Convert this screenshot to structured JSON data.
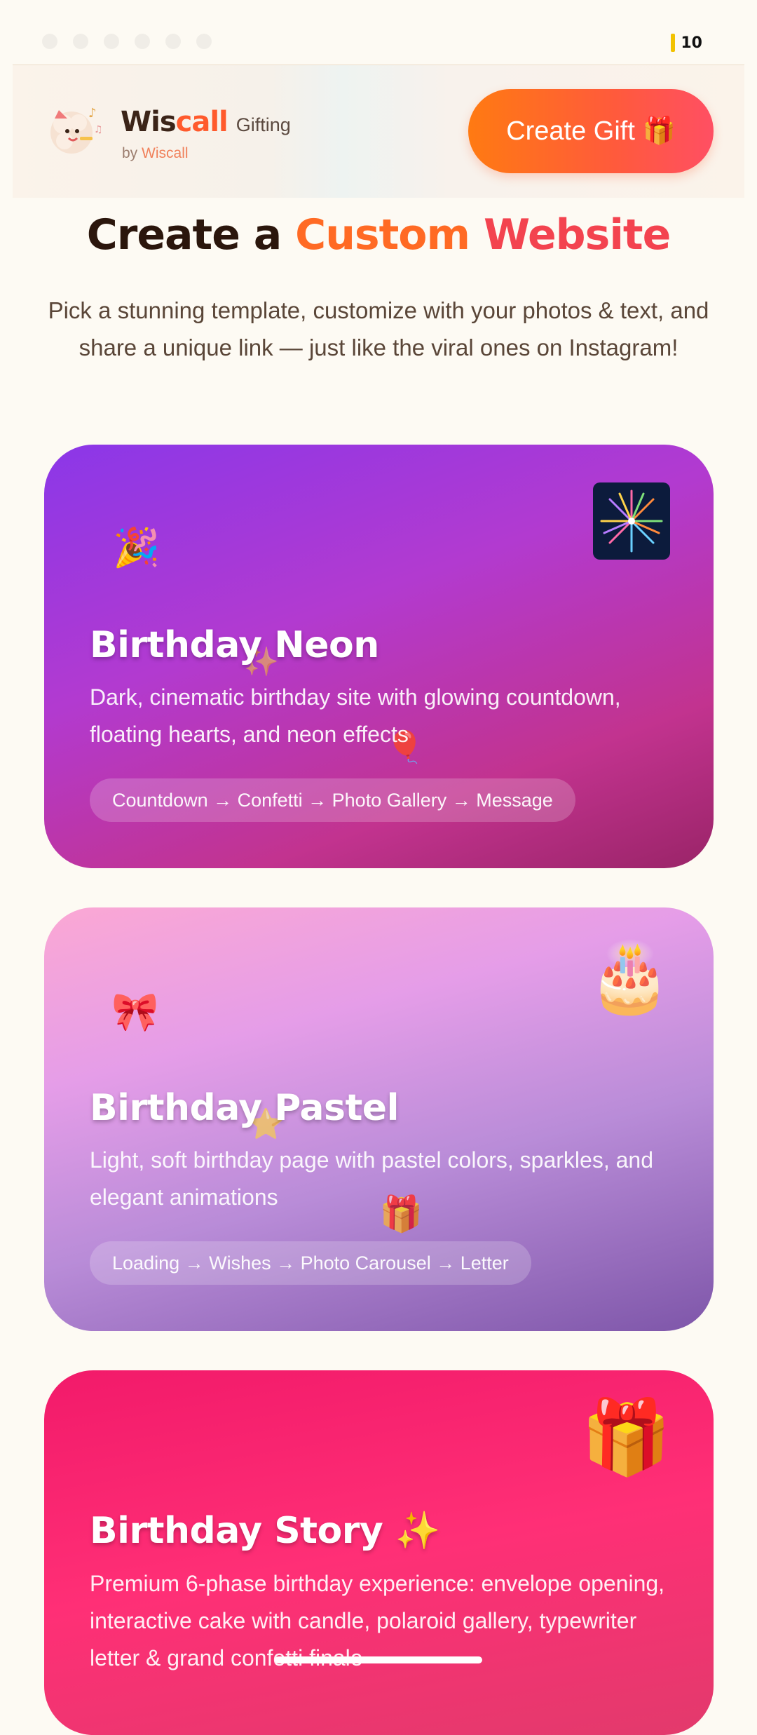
{
  "status": {
    "battery_level": "10"
  },
  "header": {
    "brand_part1": "Wis",
    "brand_part2": "call",
    "brand_suffix": "Gifting",
    "byline_prefix": "by",
    "byline_brand": "Wiscall",
    "create_button": "Create Gift 🎁"
  },
  "hero": {
    "title_part1": "Create a",
    "title_part2": "Custom",
    "title_part3": "Website",
    "subtitle": "Pick a stunning template, customize with your photos & text, and share a unique link — just like the viral ones on Instagram!"
  },
  "templates": [
    {
      "title": "Birthday Neon",
      "description": "Dark, cinematic birthday site with glowing countdown, floating hearts, and neon effects",
      "flow": "Countdown → Confetti → Photo Gallery → Message",
      "icon": "fireworks-icon",
      "accent": "#8b37e8"
    },
    {
      "title": "Birthday Pastel",
      "description": "Light, soft birthday page with pastel colors, sparkles, and elegant animations",
      "flow": "Loading → Wishes → Photo Carousel → Letter",
      "icon": "cake-icon",
      "accent": "#e59de8"
    },
    {
      "title": "Birthday Story ✨",
      "description": "Premium 6-phase birthday experience: envelope opening, interactive cake with candle, polaroid gallery, typewriter letter & grand confetti finale",
      "icon": "gift-icon",
      "accent": "#f21a6a"
    }
  ]
}
